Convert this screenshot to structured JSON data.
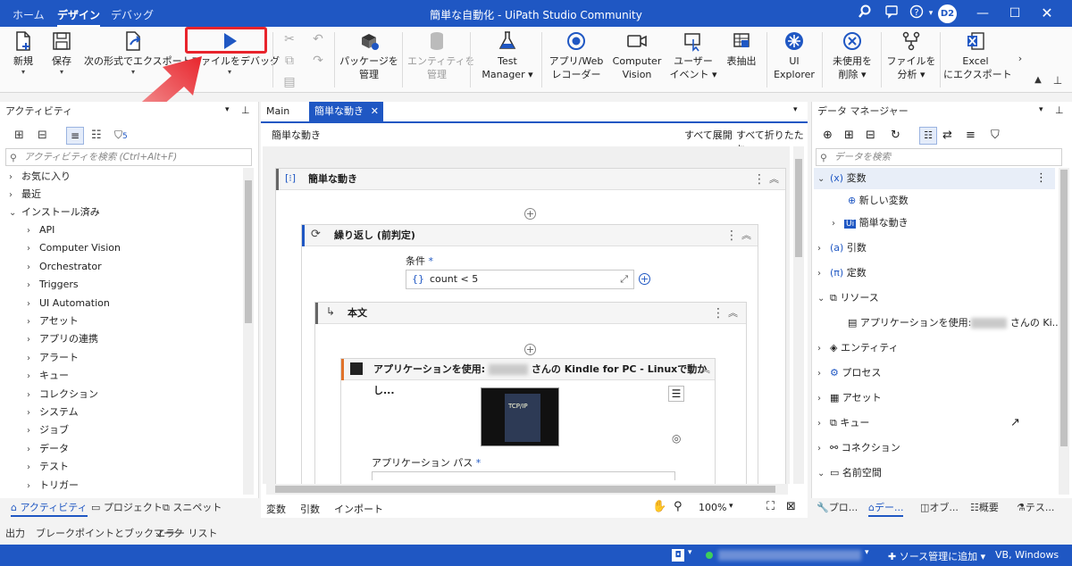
{
  "titlebar": {
    "tabs": [
      "ホーム",
      "デザイン",
      "デバッグ"
    ],
    "window_title": "簡単な自動化 - UiPath Studio Community",
    "avatar": "D2"
  },
  "ribbon": {
    "new": "新規",
    "save": "保存",
    "export": "次の形式でエクスポート:",
    "debug": "ファイルをデバッグ",
    "packages_1": "パッケージを",
    "packages_2": "管理",
    "entities_1": "エンティティを",
    "entities_2": "管理",
    "test_1": "Test",
    "test_2": "Manager",
    "recorder_1": "アプリ/Web",
    "recorder_2": "レコーダー",
    "cv_1": "Computer",
    "cv_2": "Vision",
    "userevent_1": "ユーザー",
    "userevent_2": "イベント",
    "extract": "表抽出",
    "uiexp_1": "UI",
    "uiexp_2": "Explorer",
    "removeunused_1": "未使用を",
    "removeunused_2": "削除",
    "analyze_1": "ファイルを",
    "analyze_2": "分析",
    "excel_1": "Excel",
    "excel_2": "にエクスポート"
  },
  "left": {
    "title": "アクティビティ",
    "filter_count": "5",
    "search_placeholder": "アクティビティを検索 (Ctrl+Alt+F)",
    "top_items": [
      "お気に入り",
      "最近",
      "インストール済み"
    ],
    "sub_items": [
      "API",
      "Computer Vision",
      "Orchestrator",
      "Triggers",
      "UI Automation",
      "アセット",
      "アプリの連携",
      "アラート",
      "キュー",
      "コレクション",
      "システム",
      "ジョブ",
      "データ",
      "テスト",
      "トリガー"
    ],
    "tabs": [
      "アクティビティ",
      "プロジェクト",
      "スニペット"
    ]
  },
  "center": {
    "tabs": [
      "Main",
      "簡単な動き"
    ],
    "breadcrumb": "簡単な動き",
    "expand_all": "すべて展開",
    "collapse_all": "すべて折りたたむ",
    "seq_title": "簡単な動き",
    "loop_title": "繰り返し (前判定)",
    "condition_label": "条件",
    "condition_value": "count < 5",
    "body_title": "本文",
    "app_title_prefix": "アプリケーションを使用: ",
    "app_title_suffix": "さんの Kindle for PC - Linuxで動かし...",
    "app_path_label": "アプリケーション パス",
    "book_title": "TCP/IP",
    "bottom_tabs": [
      "変数",
      "引数",
      "インポート"
    ],
    "zoom": "100%"
  },
  "right": {
    "title": "データ マネージャー",
    "search_placeholder": "データを検索",
    "items": [
      "変数",
      "新しい変数",
      "簡単な動き",
      "引数",
      "定数",
      "リソース",
      "アプリケーションを使用:",
      "エンティティ",
      "プロセス",
      "アセット",
      "キュー",
      "コネクション",
      "名前空間"
    ],
    "resource_suffix": "さんの Ki...",
    "tabs": [
      "プロ...",
      "デー...",
      "オブ...",
      "概要",
      "テス..."
    ]
  },
  "output": [
    "出力",
    "ブレークポイントとブックマーク",
    "エラー リスト"
  ],
  "status": {
    "add_source": "ソース管理に追加",
    "lang": "VB, Windows"
  },
  "colors": {
    "accent": "#1f57c3",
    "highlight": "#e8242c"
  }
}
